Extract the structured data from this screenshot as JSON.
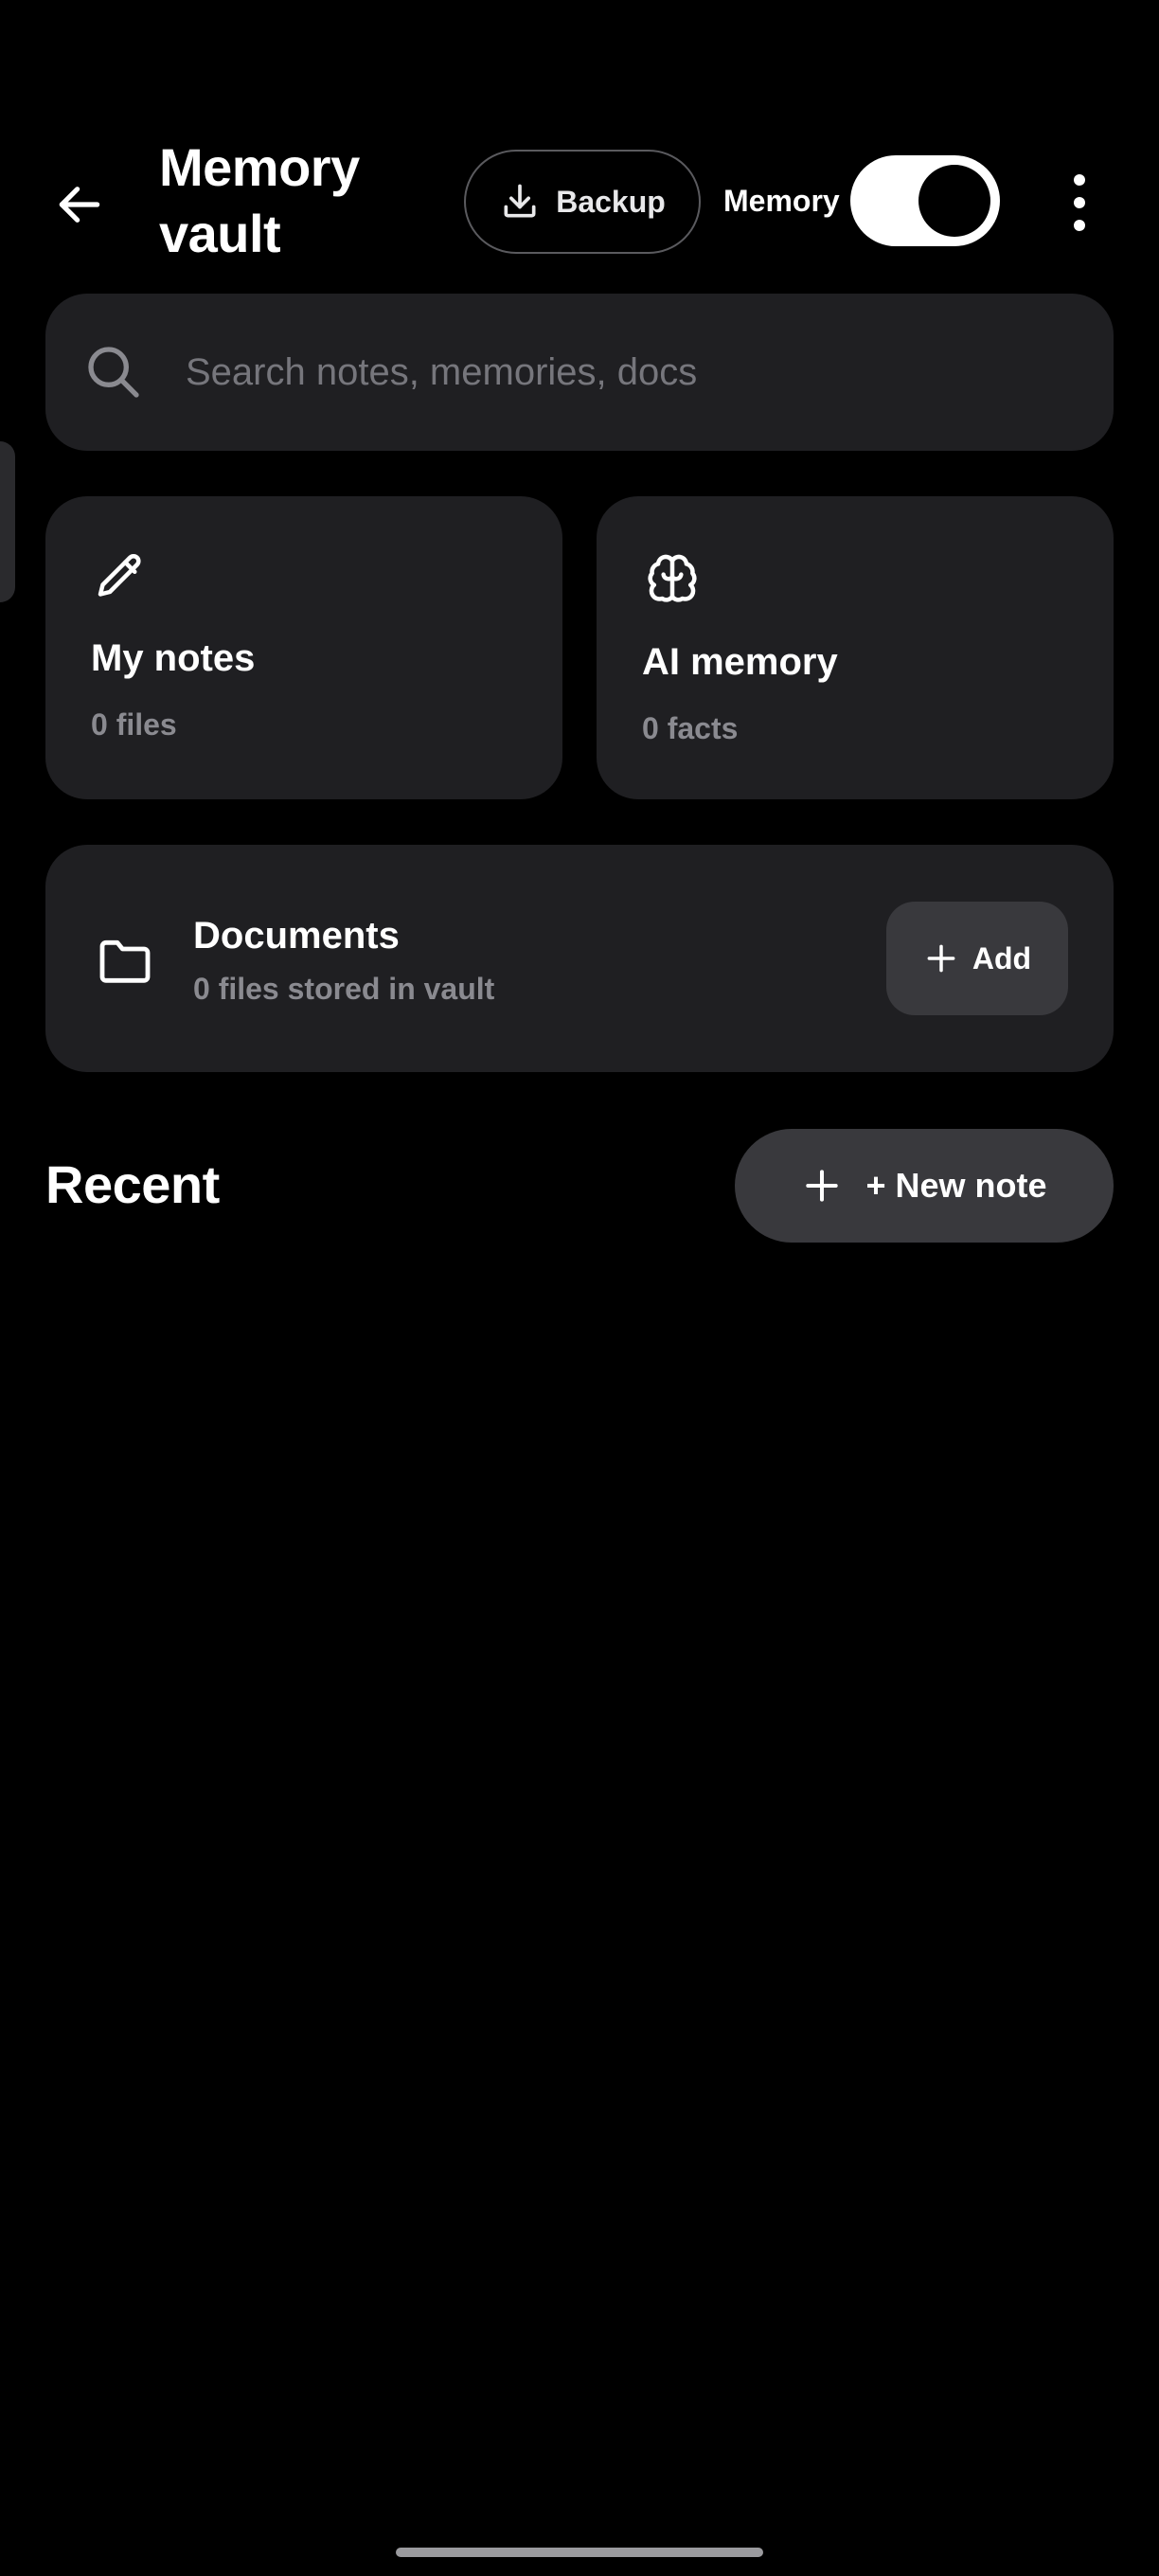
{
  "header": {
    "title": "Memory vault",
    "back_icon": "arrow-left-icon",
    "backup_label": "Backup",
    "backup_icon": "download-icon",
    "memory_toggle_label": "Memory",
    "memory_toggle_on": true,
    "more_icon": "more-vertical-icon"
  },
  "search": {
    "placeholder": "Search notes, memories, docs",
    "icon": "search-icon"
  },
  "cards": {
    "notes": {
      "title": "My notes",
      "subtitle": "0 files",
      "icon": "pencil-icon"
    },
    "memory": {
      "title": "AI memory",
      "subtitle": "0 facts",
      "icon": "brain-icon"
    }
  },
  "documents": {
    "title": "Documents",
    "subtitle": "0 files stored in vault",
    "icon": "folder-icon",
    "add_label": "Add",
    "add_icon": "plus-icon"
  },
  "recent": {
    "title": "Recent",
    "new_note_label": "+ New note",
    "new_note_icon": "plus-icon"
  },
  "colors": {
    "background": "#000000",
    "surface": "#1f1f22",
    "button_surface": "#39393d",
    "muted_text": "#8a8a90",
    "placeholder_text": "#76767c",
    "toggle_on": "#ffffff"
  }
}
